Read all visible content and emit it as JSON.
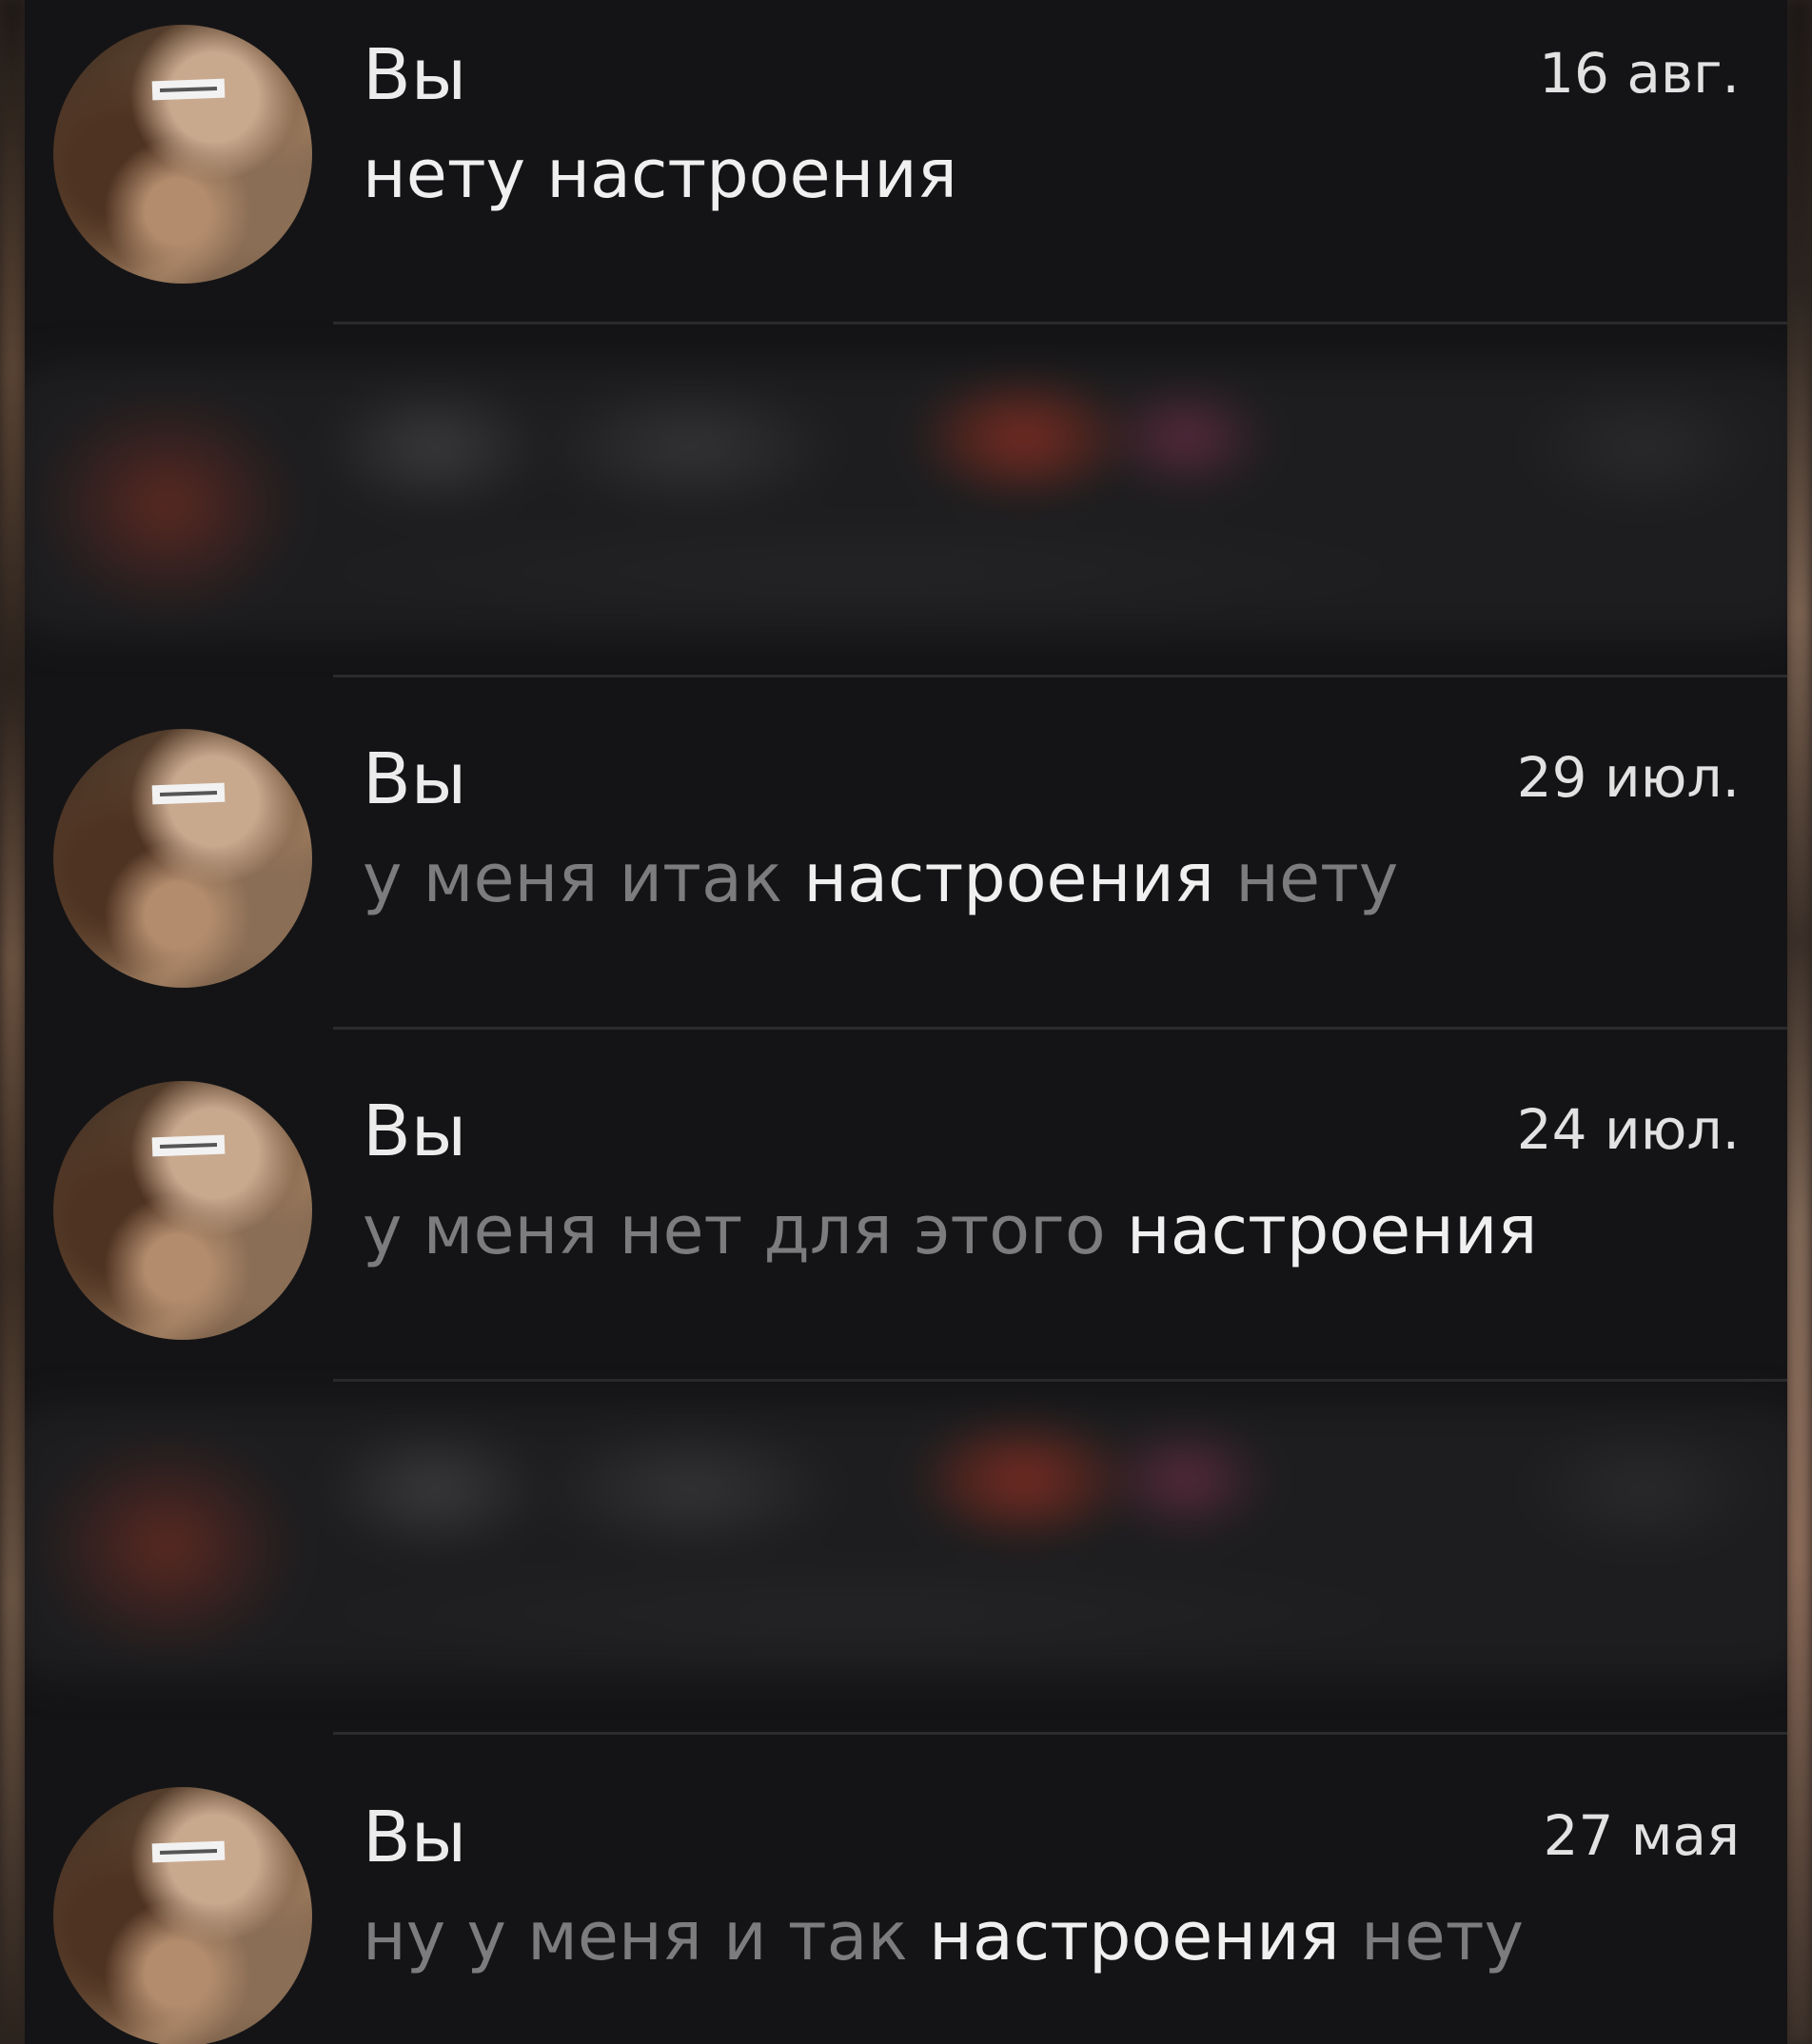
{
  "conversations": [
    {
      "sender": "Вы",
      "date": "16 авг.",
      "message": "нету настроения"
    },
    {
      "sender": "Вы",
      "date": "29 июл.",
      "message_before": "у меня итак ",
      "message_highlight": "настроения",
      "message_after": " нету"
    },
    {
      "sender": "Вы",
      "date": "24 июл.",
      "message_before": "у меня нет для этого ",
      "message_highlight": "настроения",
      "message_after": ""
    },
    {
      "sender": "Вы",
      "date": "27 мая",
      "message_before": "ну у меня и так ",
      "message_highlight": "настроения",
      "message_after": " нету"
    }
  ],
  "colors": {
    "background": "#141416",
    "highlight_text": "#f0f0f0",
    "dim_text": "#7c7c7f",
    "divider": "#2b2b2e"
  },
  "icons": {
    "avatar": "user-avatar-photo"
  }
}
